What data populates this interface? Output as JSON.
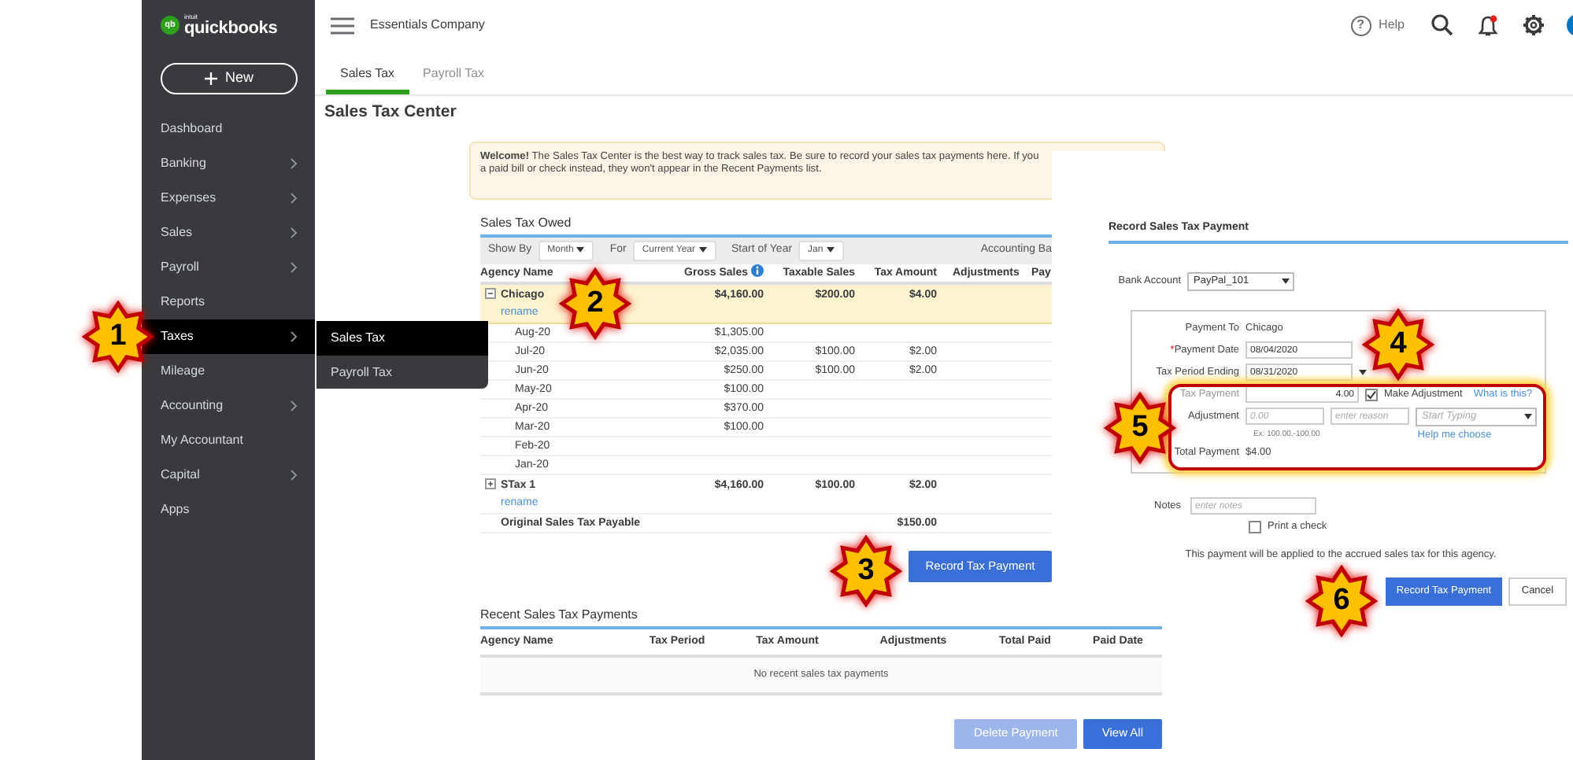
{
  "app": {
    "logo_glyph": "qb",
    "brand_small": "intuit",
    "brand": "quickbooks",
    "new_button": "New"
  },
  "sidebar": {
    "items": [
      {
        "label": "Dashboard",
        "has_submenu": false,
        "selected": false
      },
      {
        "label": "Banking",
        "has_submenu": true,
        "selected": false
      },
      {
        "label": "Expenses",
        "has_submenu": true,
        "selected": false
      },
      {
        "label": "Sales",
        "has_submenu": true,
        "selected": false
      },
      {
        "label": "Payroll",
        "has_submenu": true,
        "selected": false
      },
      {
        "label": "Reports",
        "has_submenu": false,
        "selected": false
      },
      {
        "label": "Taxes",
        "has_submenu": true,
        "selected": true
      },
      {
        "label": "Mileage",
        "has_submenu": false,
        "selected": false
      },
      {
        "label": "Accounting",
        "has_submenu": true,
        "selected": false
      },
      {
        "label": "My Accountant",
        "has_submenu": false,
        "selected": false
      },
      {
        "label": "Capital",
        "has_submenu": true,
        "selected": false
      },
      {
        "label": "Apps",
        "has_submenu": false,
        "selected": false
      }
    ]
  },
  "flyout": {
    "items": [
      {
        "label": "Sales Tax",
        "selected": true
      },
      {
        "label": "Payroll Tax",
        "selected": false
      }
    ]
  },
  "header": {
    "company": "Essentials Company",
    "help_glyph": "?",
    "help": "Help",
    "notification_unread": true
  },
  "tabs": [
    {
      "label": "Sales Tax",
      "selected": true
    },
    {
      "label": "Payroll Tax",
      "selected": false
    }
  ],
  "page_title": "Sales Tax Center",
  "notice": {
    "text": "**Welcome!** The Sales Tax Center is the best way to track sales tax. Be sure to record your sales tax payments here. If you\na paid bill or check instead, they won't appear in the Recent Payments list."
  },
  "sales_tax_owed": {
    "title": "Sales Tax Owed",
    "filters": [
      {
        "label": "Show By",
        "value": "Month"
      },
      {
        "label": "For",
        "value": "Current Year"
      },
      {
        "label": "Start of Year",
        "value": "Jan"
      }
    ],
    "accounting_basis": "Accounting Ba",
    "columns": [
      "Agency Name",
      "Gross Sales",
      "Taxable Sales",
      "Tax Amount",
      "Adjustments",
      "Pay"
    ],
    "rows": [
      {
        "kind": "agency",
        "name": "Chicago",
        "link": "rename",
        "expanded": true,
        "selected": true,
        "gross_sales": "$4,160.00",
        "taxable_sales": "$200.00",
        "tax_amount": "$4.00"
      },
      {
        "kind": "period",
        "name": "Aug-20",
        "selected": false,
        "gross_sales": "$1,305.00"
      },
      {
        "kind": "period",
        "name": "Jul-20",
        "selected": false,
        "gross_sales": "$2,035.00",
        "taxable_sales": "$100.00",
        "tax_amount": "$2.00"
      },
      {
        "kind": "period",
        "name": "Jun-20",
        "selected": false,
        "gross_sales": "$250.00",
        "taxable_sales": "$100.00",
        "tax_amount": "$2.00"
      },
      {
        "kind": "period",
        "name": "May-20",
        "selected": false,
        "gross_sales": "$100.00"
      },
      {
        "kind": "period",
        "name": "Apr-20",
        "selected": false,
        "gross_sales": "$370.00"
      },
      {
        "kind": "period",
        "name": "Mar-20",
        "selected": false,
        "gross_sales": "$100.00"
      },
      {
        "kind": "period",
        "name": "Feb-20",
        "selected": false
      },
      {
        "kind": "period",
        "name": "Jan-20",
        "selected": false
      },
      {
        "kind": "agency",
        "name": "STax 1",
        "link": "rename",
        "expanded": false,
        "selected": false,
        "gross_sales": "$4,160.00",
        "taxable_sales": "$100.00",
        "tax_amount": "$2.00"
      },
      {
        "kind": "total",
        "name": "Original Sales Tax Payable",
        "selected": false,
        "tax_amount": "$150.00"
      }
    ]
  },
  "record_button": "Record Tax Payment",
  "recent_payments": {
    "title": "Recent Sales Tax Payments",
    "columns": [
      "Agency Name",
      "Tax Period",
      "Tax Amount",
      "Adjustments",
      "Total Paid",
      "Paid Date"
    ],
    "empty_message": "No recent sales tax payments",
    "buttons": [
      {
        "label": "Delete Payment",
        "disabled": true
      },
      {
        "label": "View All",
        "disabled": false
      }
    ]
  },
  "dialog": {
    "title": "Record Sales Tax Payment",
    "bank_account": {
      "label": "Bank Account",
      "value": "PayPal_101"
    },
    "payment_to": {
      "label": "Payment To",
      "value": "Chicago"
    },
    "payment_date": {
      "required_mark": "*",
      "label": "Payment Date",
      "value": "08/04/2020"
    },
    "tax_period_ending": {
      "label": "Tax Period Ending",
      "value": "08/31/2020"
    },
    "tax_payment": {
      "label": "Tax Payment",
      "value": "4.00"
    },
    "make_adjustment": {
      "label": "Make Adjustment",
      "checked": true
    },
    "what_is_this": "What is this?",
    "adjustment": {
      "label": "Adjustment",
      "amount_placeholder": "0.00",
      "reason_placeholder": "enter reason",
      "account_placeholder": "Start Typing",
      "hint": "Ex: 100.00,-100.00",
      "help_link": "Help me choose"
    },
    "total_payment": {
      "label": "Total Payment",
      "value": "$4.00"
    },
    "notes": {
      "label": "Notes",
      "placeholder": "enter notes"
    },
    "print_check": {
      "label": "Print a check",
      "checked": false
    },
    "info": "This payment will be applied to the accrued sales tax for this agency.",
    "buttons": [
      {
        "label": "Record Tax Payment",
        "kind": "primary"
      },
      {
        "label": "Cancel",
        "kind": "secondary"
      }
    ]
  },
  "callouts": [
    {
      "label": "1"
    },
    {
      "label": "2"
    },
    {
      "label": "3"
    },
    {
      "label": "4"
    },
    {
      "label": "5"
    },
    {
      "label": "6"
    }
  ]
}
